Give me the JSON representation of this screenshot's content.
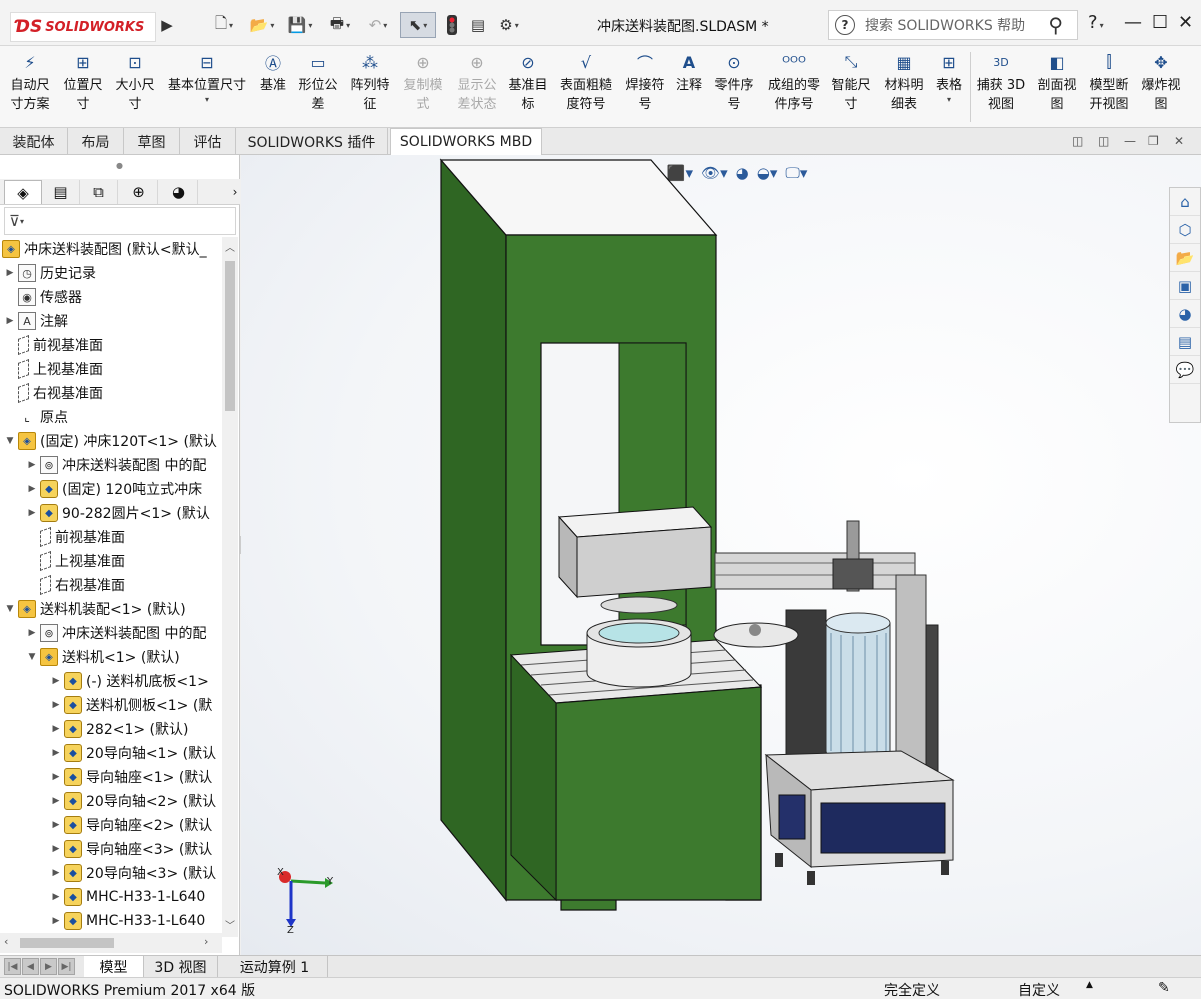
{
  "app": {
    "brand": "SOLIDWORKS",
    "document_title": "冲床送料装配图.SLDASM *"
  },
  "help_search": {
    "placeholder": "搜索 SOLIDWORKS 帮助",
    "help_label": "?"
  },
  "ribbon": {
    "items": [
      {
        "label": "自动尺\n寸方案",
        "icon": "auto-dimension-icon",
        "enabled": true
      },
      {
        "label": "位置尺\n寸",
        "icon": "location-dimension-icon",
        "enabled": true
      },
      {
        "label": "大小尺\n寸",
        "icon": "size-dimension-icon",
        "enabled": true
      },
      {
        "label": "基本位置尺寸",
        "icon": "basic-location-dimension-icon",
        "enabled": true
      },
      {
        "label": "基准",
        "icon": "datum-icon",
        "enabled": true
      },
      {
        "label": "形位公\n差",
        "icon": "geometric-tolerance-icon",
        "enabled": true
      },
      {
        "label": "阵列特\n征",
        "icon": "pattern-feature-icon",
        "enabled": true
      },
      {
        "label": "复制模\n式",
        "icon": "copy-scheme-icon",
        "enabled": false
      },
      {
        "label": "显示公\n差状态",
        "icon": "show-tolerance-status-icon",
        "enabled": false
      },
      {
        "label": "基准目\n标",
        "icon": "datum-target-icon",
        "enabled": true
      },
      {
        "label": "表面粗糙\n度符号",
        "icon": "surface-finish-icon",
        "enabled": true
      },
      {
        "label": "焊接符\n号",
        "icon": "weld-symbol-icon",
        "enabled": true
      },
      {
        "label": "注释",
        "icon": "note-icon",
        "enabled": true
      },
      {
        "label": "零件序\n号",
        "icon": "balloon-icon",
        "enabled": true
      },
      {
        "label": "成组的零\n件序号",
        "icon": "stacked-balloon-icon",
        "enabled": true
      },
      {
        "label": "智能尺\n寸",
        "icon": "smart-dimension-icon",
        "enabled": true
      },
      {
        "label": "材料明\n细表",
        "icon": "bom-icon",
        "enabled": true
      },
      {
        "label": "表格",
        "icon": "table-icon",
        "enabled": true
      },
      {
        "label": "捕获 3D\n视图",
        "icon": "capture-3d-view-icon",
        "enabled": true
      },
      {
        "label": "剖面视\n图",
        "icon": "section-view-icon",
        "enabled": true
      },
      {
        "label": "模型断\n开视图",
        "icon": "model-break-view-icon",
        "enabled": true
      },
      {
        "label": "爆炸视\n图",
        "icon": "exploded-view-icon",
        "enabled": true
      }
    ]
  },
  "command_tabs": [
    "装配体",
    "布局",
    "草图",
    "评估",
    "SOLIDWORKS 插件",
    "SOLIDWORKS MBD"
  ],
  "feature_tree": {
    "rows": [
      {
        "label": "冲床送料装配图  (默认<默认_",
        "icon": "assembly-icon"
      },
      {
        "label": "历史记录",
        "icon": "history-icon"
      },
      {
        "label": "传感器",
        "icon": "sensor-icon"
      },
      {
        "label": "注解",
        "icon": "annotations-icon"
      },
      {
        "label": "前视基准面",
        "icon": "plane-icon"
      },
      {
        "label": "上视基准面",
        "icon": "plane-icon"
      },
      {
        "label": "右视基准面",
        "icon": "plane-icon"
      },
      {
        "label": "原点",
        "icon": "origin-icon"
      },
      {
        "label": "(固定) 冲床120T<1> (默认",
        "icon": "subassembly-icon"
      },
      {
        "label": "冲床送料装配图 中的配",
        "icon": "mates-icon"
      },
      {
        "label": "(固定) 120吨立式冲床",
        "icon": "part-icon"
      },
      {
        "label": "90-282圆片<1> (默认",
        "icon": "part-icon"
      },
      {
        "label": "前视基准面",
        "icon": "plane-icon"
      },
      {
        "label": "上视基准面",
        "icon": "plane-icon"
      },
      {
        "label": "右视基准面",
        "icon": "plane-icon"
      },
      {
        "label": "送料机装配<1> (默认)",
        "icon": "subassembly-icon"
      },
      {
        "label": "冲床送料装配图 中的配",
        "icon": "mates-icon"
      },
      {
        "label": "送料机<1> (默认)",
        "icon": "subassembly-icon"
      },
      {
        "label": "(-) 送料机底板<1>",
        "icon": "part-icon"
      },
      {
        "label": "送料机侧板<1> (默",
        "icon": "part-icon"
      },
      {
        "label": "282<1> (默认)",
        "icon": "part-icon"
      },
      {
        "label": "20导向轴<1> (默认",
        "icon": "part-icon"
      },
      {
        "label": "导向轴座<1> (默认",
        "icon": "part-icon"
      },
      {
        "label": "20导向轴<2> (默认",
        "icon": "part-icon"
      },
      {
        "label": "导向轴座<2> (默认",
        "icon": "part-icon"
      },
      {
        "label": "导向轴座<3> (默认",
        "icon": "part-icon"
      },
      {
        "label": "20导向轴<3> (默认",
        "icon": "part-icon"
      },
      {
        "label": "MHC-H33-1-L640",
        "icon": "part-icon"
      },
      {
        "label": "MHC-H33-1-L640",
        "icon": "part-icon"
      }
    ]
  },
  "triad": {
    "x": "X",
    "y": "Y",
    "z": "Z"
  },
  "bottom_tabs": [
    "模型",
    "3D 视图",
    "运动算例 1"
  ],
  "status": {
    "product": "SOLIDWORKS Premium 2017 x64 版",
    "state": "完全定义",
    "units": "自定义"
  },
  "colors": {
    "press_green": "#3d7a2e",
    "brand_red": "#d32027",
    "accent_blue": "#1f4e8c"
  }
}
